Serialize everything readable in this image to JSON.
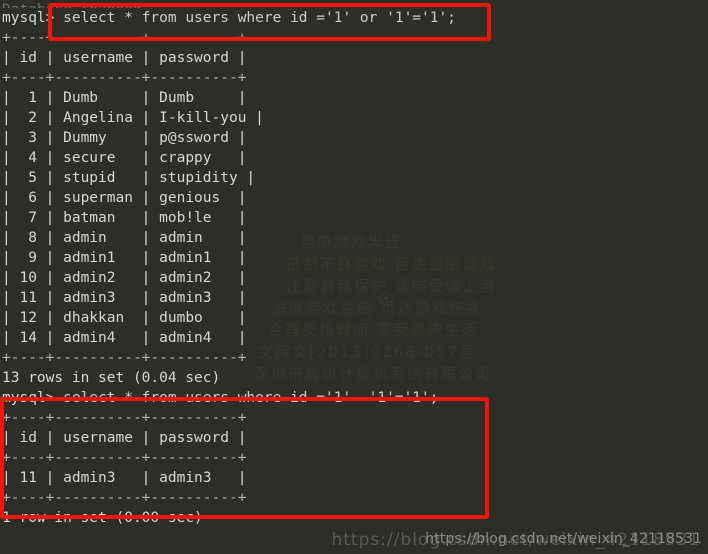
{
  "terminal": {
    "background_color": "#2e2e28",
    "text_color": "#d9d8cf",
    "annotation_color": "#f5140a",
    "scrollback_top_partial": "Database changed",
    "prompt": "mysql> ",
    "blocks": [
      {
        "id": "query-1",
        "command": "select * from users where id ='1' or '1'='1';",
        "separator": "+----+----------+----------+",
        "header": "| id | username | password |",
        "rows": [
          "|  1 | Dumb     | Dumb     |",
          "|  2 | Angelina | I-kill-you |",
          "|  3 | Dummy    | p@ssword |",
          "|  4 | secure   | crappy   |",
          "|  5 | stupid   | stupidity |",
          "|  6 | superman | genious  |",
          "|  7 | batman   | mob!le   |",
          "|  8 | admin    | admin    |",
          "|  9 | admin1   | admin1   |",
          "| 10 | admin2   | admin2   |",
          "| 11 | admin3   | admin3   |",
          "| 12 | dhakkan  | dumbo    |",
          "| 14 | admin4   | admin4   |"
        ],
        "status": "13 rows in set (0.04 sec)"
      },
      {
        "id": "query-2",
        "command": "select * from users where id ='1'  '1'='1';",
        "separator": "+----+----------+----------+",
        "header": "| id | username | password |",
        "rows": [
          "| 11 | admin3   | admin3   |"
        ],
        "status": "1 row in set (0.00 sec)"
      }
    ],
    "table_data": {
      "columns": [
        "id",
        "username",
        "password"
      ],
      "result_1": [
        {
          "id": "1",
          "username": "Dumb",
          "password": "Dumb"
        },
        {
          "id": "2",
          "username": "Angelina",
          "password": "I-kill-you"
        },
        {
          "id": "3",
          "username": "Dummy",
          "password": "p@ssword"
        },
        {
          "id": "4",
          "username": "secure",
          "password": "crappy"
        },
        {
          "id": "5",
          "username": "stupid",
          "password": "stupidity"
        },
        {
          "id": "6",
          "username": "superman",
          "password": "genious"
        },
        {
          "id": "7",
          "username": "batman",
          "password": "mob!le"
        },
        {
          "id": "8",
          "username": "admin",
          "password": "admin"
        },
        {
          "id": "9",
          "username": "admin1",
          "password": "admin1"
        },
        {
          "id": "10",
          "username": "admin2",
          "password": "admin2"
        },
        {
          "id": "11",
          "username": "admin3",
          "password": "admin3"
        },
        {
          "id": "12",
          "username": "dhakkan",
          "password": "dumbo"
        },
        {
          "id": "14",
          "username": "admin4",
          "password": "admin4"
        }
      ],
      "result_2": [
        {
          "id": "11",
          "username": "admin3",
          "password": "admin3"
        }
      ]
    }
  },
  "watermark": {
    "url": "https://blog.csdn.net/weixin_42118531",
    "ghost": "https://blog.csdn.net/weixin_42118531"
  },
  "wallpaper": {
    "lines": [
      "健康游戏忠告",
      "抵制不良游戏 拒绝盗版游戏",
      "注意自我保护 谨防受骗上当",
      "适度游戏益脑 沉迷游戏伤身",
      "合理安排时间 享受健康生活。",
      "文网文[2013]0268-057号",
      "深圳市腾讯计算机系统有限公司"
    ]
  }
}
